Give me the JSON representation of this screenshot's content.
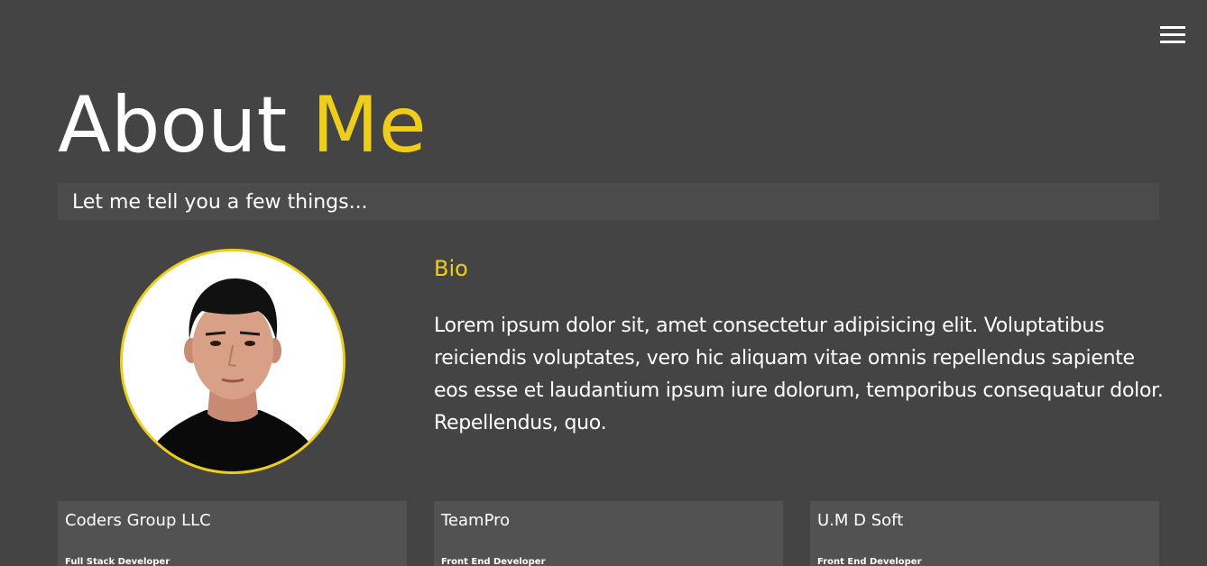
{
  "header": {
    "menu_icon": "hamburger-menu-icon"
  },
  "hero": {
    "title_part1": "About",
    "title_part2": "Me",
    "subtitle": "Let me tell you a few things..."
  },
  "bio": {
    "heading": "Bio",
    "text": "Lorem ipsum dolor sit, amet consectetur adipisicing elit. Voluptatibus reiciendis voluptates, vero hic aliquam vitae omnis repellendus sapiente eos esse et laudantium ipsum iure dolorum, temporibus consequatur dolor. Repellendus, quo."
  },
  "jobs": [
    {
      "company": "Coders Group LLC",
      "role": "Full Stack Developer"
    },
    {
      "company": "TeamPro",
      "role": "Front End Developer"
    },
    {
      "company": "U.M D Soft",
      "role": "Front End Developer"
    }
  ],
  "colors": {
    "background": "#444444",
    "accent": "#eece1a",
    "panel": "#4b4b4b",
    "card": "#525252"
  }
}
